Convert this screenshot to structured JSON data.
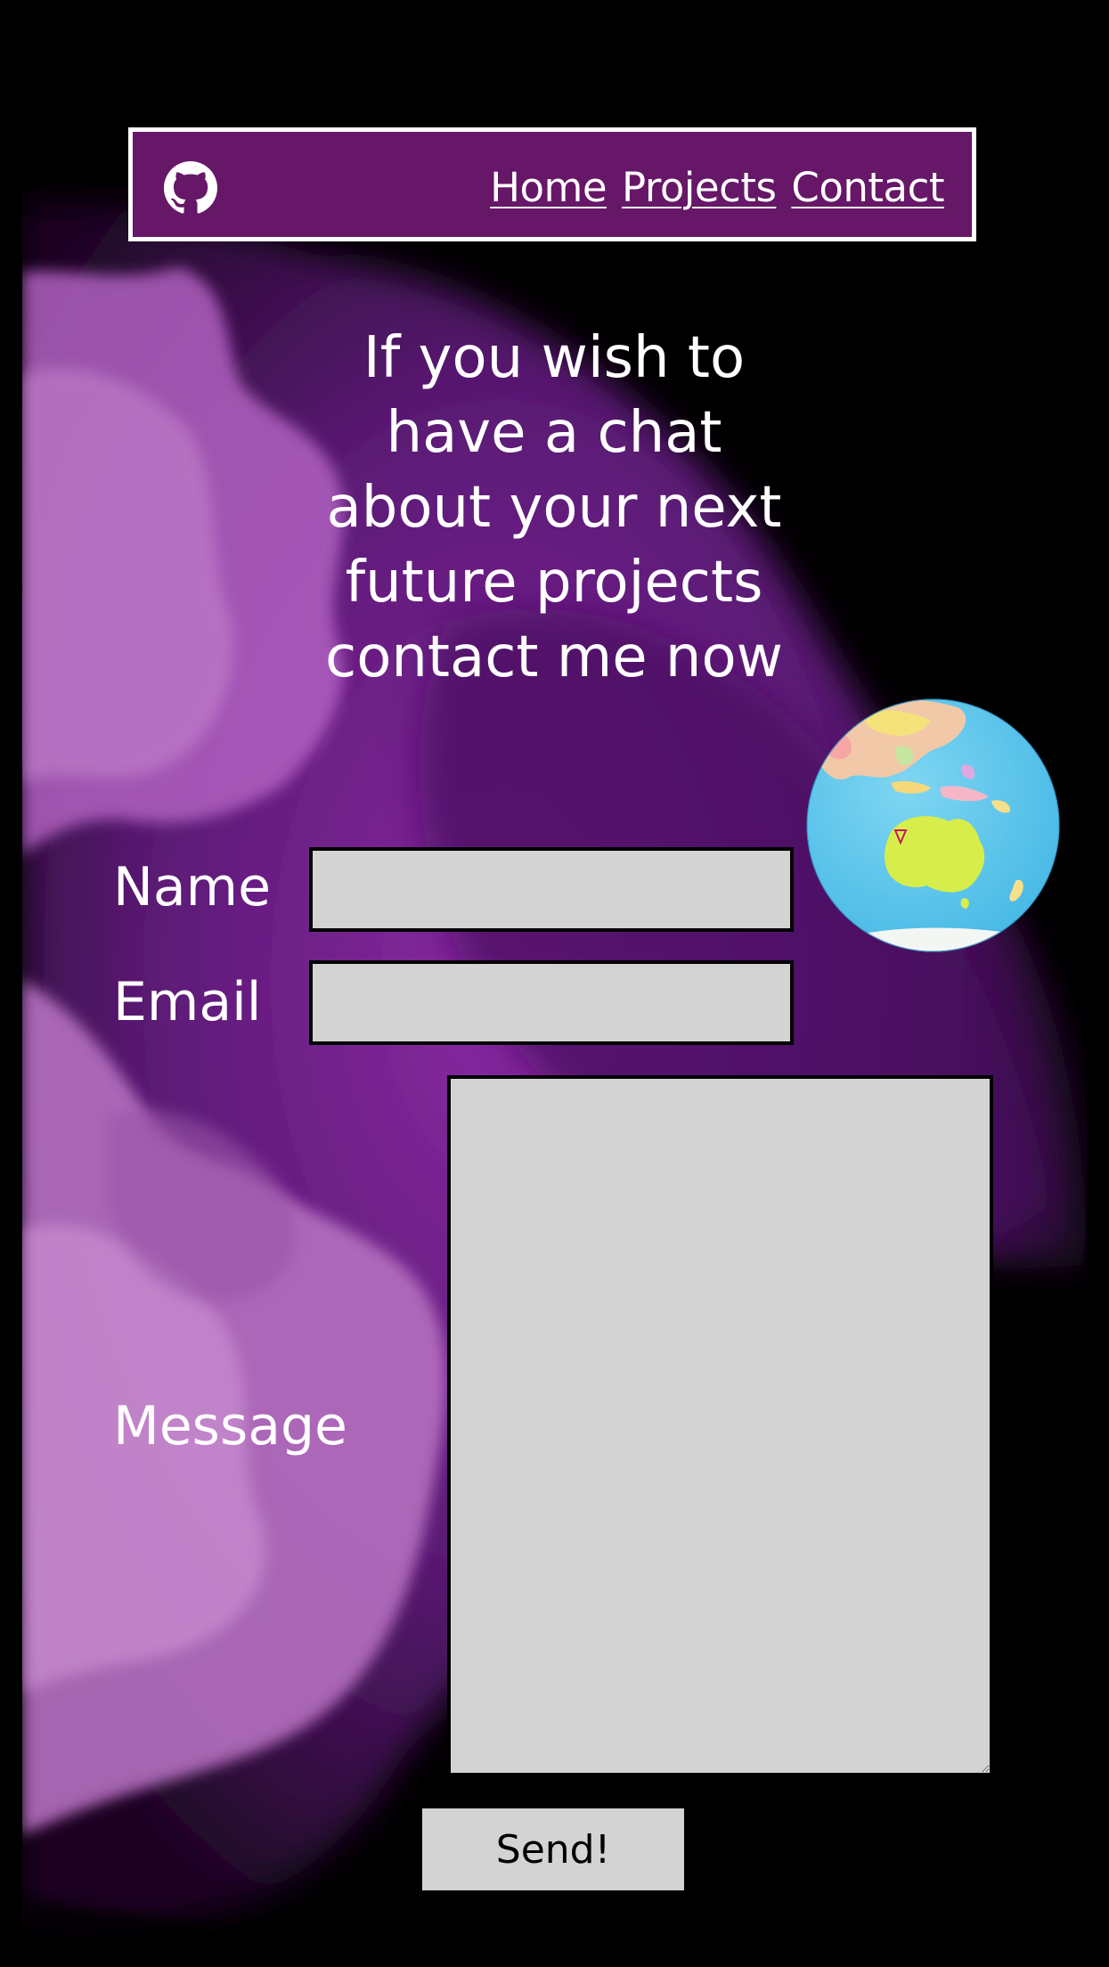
{
  "header": {
    "github_icon": "github-icon",
    "nav": [
      {
        "label": "Home"
      },
      {
        "label": "Projects"
      },
      {
        "label": "Contact"
      }
    ],
    "background_color": "#661767",
    "border_color": "#ffffff"
  },
  "main": {
    "heading_lines": [
      "If you wish to",
      "have a chat",
      "about your next",
      "future projects",
      "contact me now"
    ],
    "globe_icon": "globe-australia-icon"
  },
  "form": {
    "name_label": "Name",
    "name_value": "",
    "email_label": "Email",
    "email_value": "",
    "message_label": "Message",
    "message_value": "",
    "send_label": "Send!",
    "field_color": "#d3d3d3"
  },
  "colors": {
    "page_background": "#000000",
    "accent_purple": "#661767",
    "watercolor_purple": "#7a2a8f"
  }
}
